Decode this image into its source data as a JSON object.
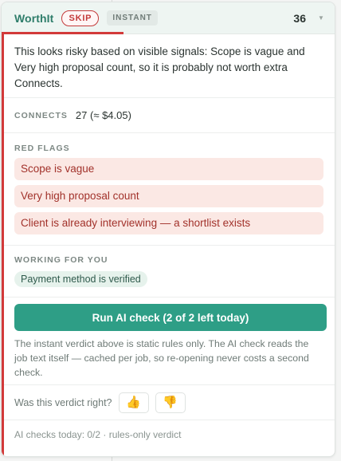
{
  "header": {
    "brand": "WorthIt",
    "verdict_badge": "SKIP",
    "mode_badge": "INSTANT",
    "score": "36",
    "chevron_icon": "chevron-down-icon"
  },
  "summary": {
    "text": "This looks risky based on visible signals: Scope is vague and Very high proposal count, so it is probably not worth extra Connects."
  },
  "connects": {
    "label": "CONNECTS",
    "value": "27 (≈ $4.05)"
  },
  "red_flags": {
    "label": "RED FLAGS",
    "items": [
      "Scope is vague",
      "Very high proposal count",
      "Client is already interviewing — a shortlist exists"
    ]
  },
  "working_for_you": {
    "label": "WORKING FOR YOU",
    "items": [
      "Payment method is verified"
    ]
  },
  "ai_check": {
    "button_label": "Run AI check (2 of 2 left today)",
    "note": "The instant verdict above is static rules only. The AI check reads the job text itself — cached per job, so re-opening never costs a second check."
  },
  "feedback": {
    "question": "Was this verdict right?",
    "thumbs_up": "👍",
    "thumbs_down": "👎"
  },
  "footer": {
    "text": "AI checks today: 0/2 · rules-only verdict"
  },
  "colors": {
    "brand": "#2e7d6a",
    "danger": "#d23a3a",
    "primary_button": "#2e9e86",
    "flag_bg": "#fbe8e4",
    "positive_pill_bg": "#e6f2ec"
  }
}
